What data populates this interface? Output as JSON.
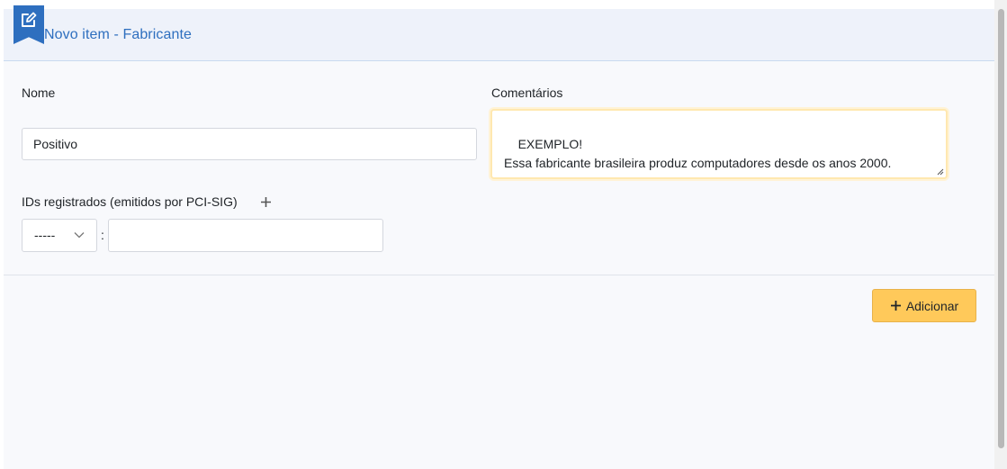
{
  "header": {
    "title": "Novo item - Fabricante",
    "icon": "edit-icon",
    "accent_color": "#2e6fbf"
  },
  "form": {
    "nome_label": "Nome",
    "nome_value": "Positivo",
    "comentarios_label": "Comentários",
    "comentarios_value": "EXEMPLO!\nEssa fabricante brasileira produz computadores desde os anos 2000.",
    "ids_label": "IDs registrados (emitidos por PCI-SIG)",
    "ids_add_icon": "plus-icon",
    "select_value": "-----",
    "colon": ":",
    "id_value": ""
  },
  "actions": {
    "add_label": "Adicionar",
    "add_icon": "plus-icon",
    "add_color": "#ffc95a"
  }
}
